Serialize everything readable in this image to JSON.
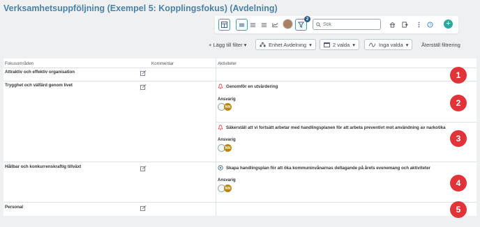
{
  "title": "Verksamhetsuppföljning (Exempel 5: Kopplingsfokus) (Avdelning)",
  "toolbar": {
    "view_table_icon": "table-icon",
    "view_list_icon": "list-icon",
    "filter_badge": "2",
    "search_placeholder": "Sök"
  },
  "filters": {
    "add_filter_label": "+ Lägg till filter",
    "unit_label": "Enhet Avdelning",
    "period_label": "2 valda",
    "trend_label": "Inga valda",
    "reset_label": "Återställ filtrering"
  },
  "table": {
    "headers": {
      "focus": "Fokusområden",
      "comment": "Kommentar",
      "activities": "Aktiviteter"
    },
    "rows": [
      {
        "area": "Attraktiv och effektiv organisation"
      },
      {
        "area": "Trygghet och välfärd genom livet"
      },
      {
        "area": "Hållbar och konkurrenskraftig tillväxt"
      },
      {
        "area": "Personal"
      }
    ],
    "activities": [
      {
        "title": "Genomför en utvärdering",
        "responsible_label": "Ansvarig",
        "initials": "NN"
      },
      {
        "title": "Säkerställ att vi fortsätt arbetar med handlingsplanen för att arbeta preventivt mot användning av narkotika",
        "responsible_label": "Ansvarig",
        "initials": "NN"
      },
      {
        "title": "Skapa handlingsplan för att öka kommuninvånarnas deltagande på årets evenemang och aktiviteter",
        "responsible_label": "Ansvarig",
        "initials": "NN"
      }
    ]
  },
  "markers": [
    "1",
    "2",
    "3",
    "4",
    "5"
  ],
  "colors": {
    "accent": "#3aa6a6",
    "title": "#4a82a6",
    "marker": "#e0343a",
    "avatar_nn": "#b8860b"
  }
}
